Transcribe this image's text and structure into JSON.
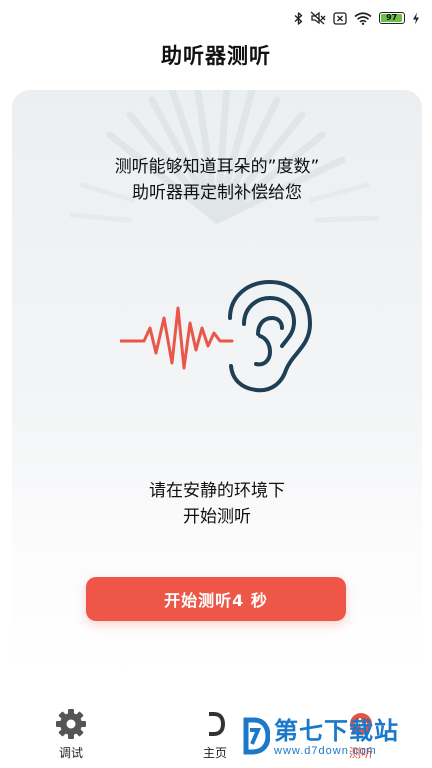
{
  "status_bar": {
    "battery_level": "97",
    "icons": [
      "bluetooth-icon",
      "mute-icon",
      "no-sim-icon",
      "wifi-icon",
      "battery-icon",
      "charging-icon"
    ],
    "battery_color": "#6cc04a"
  },
  "header": {
    "title": "助听器测听"
  },
  "card": {
    "intro_line1": "测听能够知道耳朵的”度数”",
    "intro_line2": "助听器再定制补偿给您",
    "illustration": {
      "icons": [
        "sound-wave-icon",
        "ear-icon"
      ],
      "wave_color": "#e9574a",
      "ear_color": "#1e3f55"
    },
    "tip_line1": "请在安静的环境下",
    "tip_line2": "开始测听",
    "start_button_label": "开始测听4 秒",
    "accent_color": "#ee5747"
  },
  "tabs": [
    {
      "label": "调试",
      "icon": "gear-icon"
    },
    {
      "label": "主页",
      "icon": "home-icon"
    },
    {
      "label": "测听",
      "icon": "hearing-test-icon",
      "active": true
    }
  ],
  "watermark": {
    "main": "第七下载站",
    "sub": "www.d7down.com",
    "icon": "d7-logo-icon",
    "color": "#1b79c9"
  }
}
